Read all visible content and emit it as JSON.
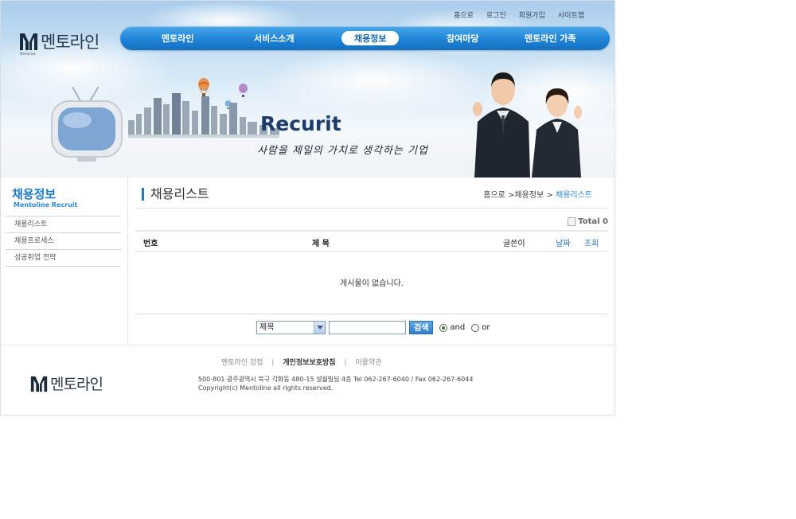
{
  "utility_links": [
    "홈으로",
    "로그인",
    "회원가입",
    "사이트맵"
  ],
  "logo": {
    "korean": "멘토라인",
    "english": "Mentoline"
  },
  "gnb": {
    "items": [
      "멘토라인",
      "서비스소개",
      "채용정보",
      "참여마당",
      "멘토라인 가족"
    ],
    "active": "채용정보"
  },
  "hero": {
    "title": "Recurit",
    "slogan": "사람을 제일의 가치로 생각하는 기업"
  },
  "sidebar": {
    "title": "채용정보",
    "subtitle": "Mentoline Recruit",
    "items": [
      "채용리스트",
      "채용프로세스",
      "성공취업 전략"
    ]
  },
  "content": {
    "page_title": "채용리스트",
    "breadcrumb": {
      "home": "홈으로",
      "sep": ">",
      "section": "채용정보",
      "current": "채용리스트"
    },
    "total_label": "Total 0",
    "columns": {
      "number": "번호",
      "title": "제   목",
      "writer": "글쓴이",
      "date": "날짜",
      "views": "조회"
    },
    "empty_message": "게시물이 없습니다.",
    "search": {
      "select_value": "제목",
      "input_value": "",
      "button": "검색",
      "radio_and": "and",
      "radio_or": "or",
      "selected_radio": "and"
    }
  },
  "footer": {
    "links": [
      "멘토라인 강점",
      "개인정보보호방침",
      "이용약관"
    ],
    "address": "500-801 광주광역시 북구 각화동 480-15 설월빌딩 4층  Tel 062-267-6040 / Fax 062-267-6044",
    "copyright": "Copyright(c) Mentoline all rights reserved."
  },
  "colors": {
    "brand_blue": "#1f84d6",
    "heading_blue": "#1b7ccf",
    "navy": "#1c3c6e"
  }
}
